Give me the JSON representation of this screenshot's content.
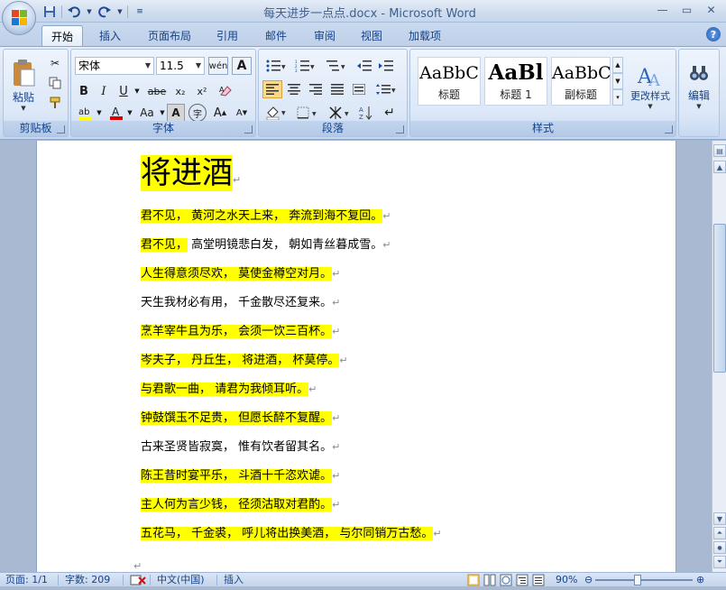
{
  "window": {
    "title": "每天进步一点点.docx - Microsoft Word",
    "minimize": "—",
    "restore": "▭",
    "close": "✕"
  },
  "quick_access": {
    "save_icon": "save-icon",
    "undo_icon": "undo-icon",
    "redo_icon": "redo-icon"
  },
  "tabs": [
    {
      "label": "开始",
      "active": true
    },
    {
      "label": "插入"
    },
    {
      "label": "页面布局"
    },
    {
      "label": "引用"
    },
    {
      "label": "邮件"
    },
    {
      "label": "审阅"
    },
    {
      "label": "视图"
    },
    {
      "label": "加载项"
    }
  ],
  "help": "?",
  "ribbon": {
    "clipboard": {
      "group_label": "剪贴板",
      "paste_label": "粘贴"
    },
    "font": {
      "group_label": "字体",
      "font_name": "宋体",
      "font_size": "11.5",
      "wen_button": "wén",
      "bold": "B",
      "italic": "I",
      "underline": "U",
      "strikethrough": "abe",
      "subscript": "x₂",
      "superscript": "x²",
      "change_case": "Aa",
      "grow_font": "A",
      "shrink_font": "A"
    },
    "paragraph": {
      "group_label": "段落"
    },
    "styles": {
      "group_label": "样式",
      "items": [
        {
          "sample": "AaBbC",
          "name": "标题"
        },
        {
          "sample": "AaBl",
          "name": "标题 1"
        },
        {
          "sample": "AaBbC",
          "name": "副标题"
        }
      ],
      "change_styles_label": "更改样式"
    },
    "editing": {
      "label": "编辑"
    }
  },
  "document": {
    "title": "将进酒",
    "lines": [
      {
        "text": "君不见，  黄河之水天上来，  奔流到海不复回。",
        "highlight": "full"
      },
      {
        "text_hl": "君不见，",
        "text_rest": " 高堂明镜悲白发，  朝如青丝暮成雪。",
        "highlight": "partial"
      },
      {
        "text": "人生得意须尽欢，  莫使金樽空对月。",
        "highlight": "full"
      },
      {
        "text": "天生我材必有用，  千金散尽还复来。",
        "highlight": "none"
      },
      {
        "text": "烹羊宰牛且为乐，  会须一饮三百杯。",
        "highlight": "full"
      },
      {
        "text": "岑夫子，  丹丘生，  将进酒，  杯莫停。",
        "highlight": "full"
      },
      {
        "text": "与君歌一曲，  请君为我倾耳听。",
        "highlight": "full"
      },
      {
        "text": "钟鼓馔玉不足贵，  但愿长醉不复醒。",
        "highlight": "full"
      },
      {
        "text": "古来圣贤皆寂寞，  惟有饮者留其名。",
        "highlight": "none"
      },
      {
        "text": "陈王昔时宴平乐，  斗酒十千恣欢谑。",
        "highlight": "full"
      },
      {
        "text": "主人何为言少钱，  径须沽取对君酌。",
        "highlight": "full"
      },
      {
        "text": "五花马，  千金裘，  呼儿将出换美酒，  与尔同销万古愁。",
        "highlight": "full"
      }
    ],
    "paragraph_mark": "↵"
  },
  "statusbar": {
    "page": "页面: 1/1",
    "words": "字数: 209",
    "language": "中文(中国)",
    "mode": "插入",
    "zoom": "90%",
    "zoom_level": 0.9
  },
  "colors": {
    "highlight": "#ffff00",
    "ribbon_text": "#15428b"
  }
}
